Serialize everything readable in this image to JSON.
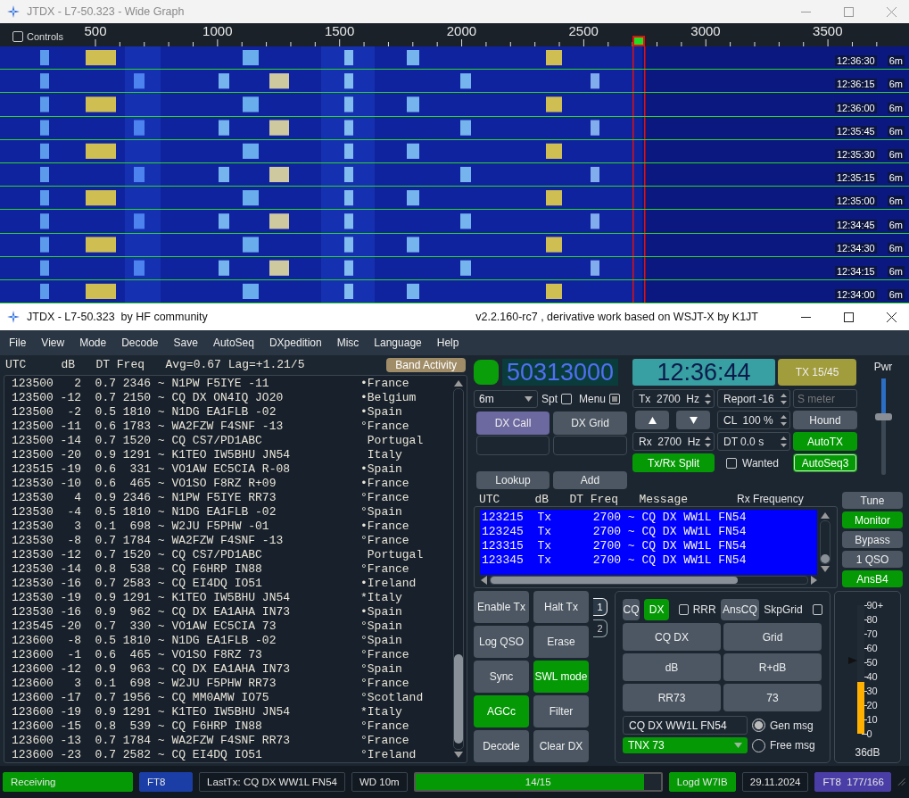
{
  "wide_graph": {
    "title": "JTDX - L7-50.323 - Wide Graph",
    "controls": {
      "label": "Controls",
      "checked": false
    },
    "scale": [
      "500",
      "1000",
      "1500",
      "2000",
      "2500",
      "3000",
      "3500"
    ],
    "rows": [
      {
        "time": "12:36:30",
        "band": "6m"
      },
      {
        "time": "12:36:15",
        "band": "6m"
      },
      {
        "time": "12:36:00",
        "band": "6m"
      },
      {
        "time": "12:35:45",
        "band": "6m"
      },
      {
        "time": "12:35:30",
        "band": "6m"
      },
      {
        "time": "12:35:15",
        "band": "6m"
      },
      {
        "time": "12:35:00",
        "band": "6m"
      },
      {
        "time": "12:34:45",
        "band": "6m"
      },
      {
        "time": "12:34:30",
        "band": "6m"
      },
      {
        "time": "12:34:15",
        "band": "6m"
      },
      {
        "time": "12:34:00",
        "band": "6m"
      }
    ]
  },
  "main_window": {
    "title": "JTDX - L7-50.323  by HF community",
    "version": "v2.2.160-rc7 , derivative work based on WSJT-X by K1JT"
  },
  "menu": [
    "File",
    "View",
    "Mode",
    "Decode",
    "Save",
    "AutoSeq",
    "DXpedition",
    "Misc",
    "Language",
    "Help"
  ],
  "band_activity": {
    "header": "UTC     dB   DT Freq   Avg=0.67 Lag=+1.21/5",
    "button": "Band Activity",
    "rows": [
      {
        "line": "123500   2  0.7 2346 ~ N1PW F5IYE -11",
        "country": "•France"
      },
      {
        "line": "123500 -12  0.7 2150 ~ CQ DX ON4IQ JO20",
        "country": "•Belgium"
      },
      {
        "line": "123500  -2  0.5 1810 ~ N1DG EA1FLB -02",
        "country": "•Spain"
      },
      {
        "line": "123500 -11  0.6 1783 ~ WA2FZW F4SNF -13",
        "country": "°France"
      },
      {
        "line": "123500 -14  0.7 1520 ~ CQ CS7/PD1ABC",
        "country": " Portugal"
      },
      {
        "line": "123500 -20  0.9 1291 ~ K1TEO IW5BHU JN54",
        "country": " Italy"
      },
      {
        "line": "123515 -19  0.6  331 ~ VO1AW EC5CIA R-08",
        "country": "•Spain"
      },
      {
        "line": "123530 -10  0.6  465 ~ VO1SO F8RZ R+09",
        "country": "•France"
      },
      {
        "line": "123530   4  0.9 2346 ~ N1PW F5IYE RR73",
        "country": "°France"
      },
      {
        "line": "123530  -4  0.5 1810 ~ N1DG EA1FLB -02",
        "country": "°Spain"
      },
      {
        "line": "123530   3  0.1  698 ~ W2JU F5PHW -01",
        "country": "•France"
      },
      {
        "line": "123530  -8  0.7 1784 ~ WA2FZW F4SNF -13",
        "country": "°France"
      },
      {
        "line": "123530 -12  0.7 1520 ~ CQ CS7/PD1ABC",
        "country": " Portugal"
      },
      {
        "line": "123530 -14  0.8  538 ~ CQ F6HRP IN88",
        "country": "°France"
      },
      {
        "line": "123530 -16  0.7 2583 ~ CQ EI4DQ IO51",
        "country": "•Ireland"
      },
      {
        "line": "123530 -19  0.9 1291 ~ K1TEO IW5BHU JN54",
        "country": "*Italy"
      },
      {
        "line": "123530 -16  0.9  962 ~ CQ DX EA1AHA IN73",
        "country": "•Spain"
      },
      {
        "line": "123545 -20  0.7  330 ~ VO1AW EC5CIA 73",
        "country": "°Spain"
      },
      {
        "line": "123600  -8  0.5 1810 ~ N1DG EA1FLB -02",
        "country": "°Spain"
      },
      {
        "line": "123600  -1  0.6  465 ~ VO1SO F8RZ 73",
        "country": "°France"
      },
      {
        "line": "123600 -12  0.9  963 ~ CQ DX EA1AHA IN73",
        "country": "°Spain"
      },
      {
        "line": "123600   3  0.1  698 ~ W2JU F5PHW RR73",
        "country": "°France"
      },
      {
        "line": "123600 -17  0.7 1956 ~ CQ MM0AMW IO75",
        "country": "°Scotland"
      },
      {
        "line": "123600 -19  0.9 1291 ~ K1TEO IW5BHU JN54",
        "country": "*Italy"
      },
      {
        "line": "123600 -15  0.8  539 ~ CQ F6HRP IN88",
        "country": "°France"
      },
      {
        "line": "123600 -13  0.7 1784 ~ WA2FZW F4SNF RR73",
        "country": "°France"
      },
      {
        "line": "123600 -23  0.7 2582 ~ CQ EI4DQ IO51",
        "country": "°Ireland"
      }
    ]
  },
  "controls": {
    "frequency": "50313000",
    "clock": "12:36:44",
    "tx_period": "TX 15/45",
    "band": "6m",
    "spt": {
      "label": "Spt",
      "checked": false
    },
    "menu_toggle": {
      "label": "Menu",
      "checked": true
    },
    "dx_call": {
      "label": "DX Call"
    },
    "dx_grid": {
      "label": "DX Grid"
    },
    "lookup": {
      "label": "Lookup"
    },
    "add": {
      "label": "Add"
    },
    "tx_freq": "Tx  2700  Hz",
    "report": "Report -16",
    "s_meter": {
      "placeholder": "S meter"
    },
    "cl": "CL  100 %",
    "hound": {
      "label": "Hound",
      "on": false
    },
    "rx_freq": "Rx  2700  Hz",
    "dt": "DT 0.0 s",
    "autotx": {
      "label": "AutoTX",
      "on": true
    },
    "split": {
      "label": "Tx/Rx Split",
      "on": true
    },
    "wanted": {
      "label": "Wanted",
      "checked": false
    },
    "autoseq": {
      "label": "AutoSeq3",
      "on": true
    },
    "power": {
      "label": "Pwr",
      "level": 0.6
    }
  },
  "rx_panel": {
    "header": "UTC     dB   DT Freq   Message",
    "rx_frequency_label": "Rx Frequency",
    "rows": [
      "123215  Tx      2700 ~ CQ DX WW1L FN54",
      "123245  Tx      2700 ~ CQ DX WW1L FN54",
      "123315  Tx      2700 ~ CQ DX WW1L FN54",
      "123345  Tx      2700 ~ CQ DX WW1L FN54"
    ]
  },
  "side_buttons": [
    {
      "label": "Tune",
      "on": false
    },
    {
      "label": "Monitor",
      "on": true
    },
    {
      "label": "Bypass",
      "on": false
    },
    {
      "label": "1 QSO",
      "on": false
    },
    {
      "label": "AnsB4",
      "on": true
    }
  ],
  "action_buttons": [
    {
      "label": "Enable Tx",
      "on": false
    },
    {
      "label": "Halt Tx",
      "on": false
    },
    {
      "label": "Log QSO",
      "on": false
    },
    {
      "label": "Erase",
      "on": false
    },
    {
      "label": "Sync",
      "on": false
    },
    {
      "label": "SWL mode",
      "on": true
    },
    {
      "label": "AGCc",
      "on": true
    },
    {
      "label": "Filter",
      "on": false
    },
    {
      "label": "Decode",
      "on": false
    },
    {
      "label": "Clear DX",
      "on": false
    }
  ],
  "tabs": [
    {
      "label": "1",
      "selected": true
    },
    {
      "label": "2",
      "selected": false
    }
  ],
  "message_panel": {
    "cq": {
      "label": "CQ",
      "on": false
    },
    "dx": {
      "label": "DX",
      "on": true
    },
    "rrr": {
      "label": "RRR",
      "checked": false
    },
    "anscq": {
      "label": "AnsCQ",
      "on": false
    },
    "skpgrid": {
      "label": "SkpGrid",
      "checked": false
    },
    "messages": [
      "CQ DX",
      "Grid",
      "dB",
      "R+dB",
      "RR73",
      "73"
    ],
    "free_text": "CQ DX WW1L FN54",
    "free_select": "TNX 73",
    "modes": [
      {
        "label": "Gen msg",
        "selected": true
      },
      {
        "label": "Free msg",
        "selected": false
      }
    ]
  },
  "meter": {
    "ticks": [
      "90+",
      "80",
      "70",
      "60",
      "50",
      "40",
      "30",
      "20",
      "10",
      "0"
    ],
    "level": 0.4,
    "peak": {
      "level": 0.57
    },
    "reading": "36dB"
  },
  "status_bar": [
    {
      "kind": "status",
      "text": "Receiving"
    },
    {
      "kind": "mode",
      "text": "FT8"
    },
    {
      "kind": "text",
      "text": "LastTx: CQ DX WW1L FN54"
    },
    {
      "kind": "text",
      "text": "WD 10m"
    },
    {
      "kind": "progress",
      "text": "14/15",
      "level": 0.93
    },
    {
      "kind": "status",
      "text": "Logd W7IB"
    },
    {
      "kind": "text",
      "text": "29.11.2024"
    },
    {
      "kind": "count",
      "text": "FT8  177/166"
    }
  ]
}
